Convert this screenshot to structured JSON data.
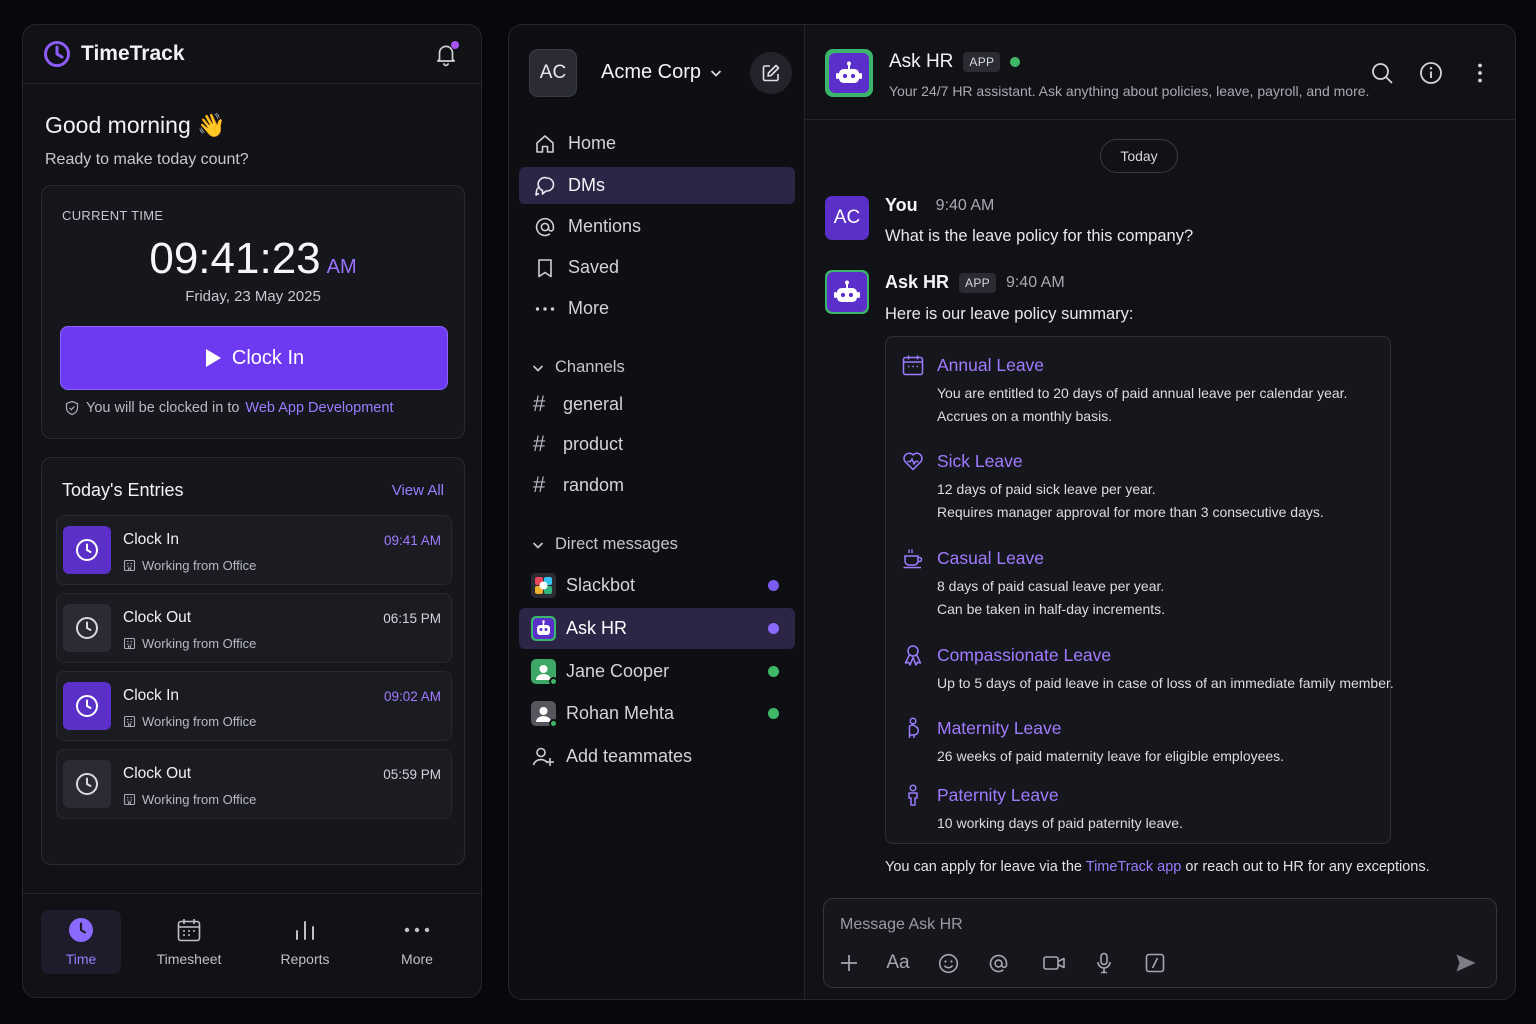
{
  "timetrack": {
    "brand": "TimeTrack",
    "greeting": "Good morning 👋",
    "subgreeting": "Ready to make today count?",
    "current_time_label": "CURRENT TIME",
    "time": "09:41:23",
    "ampm": "AM",
    "date": "Friday, 23 May 2025",
    "clock_in_label": "Clock In",
    "note_prefix": "You will be clocked in to",
    "note_project": "Web App Development",
    "entries_title": "Today's Entries",
    "view_all": "View All",
    "entries": [
      {
        "title": "Clock In",
        "sub": "Working from Office",
        "time": "09:41 AM",
        "kind": "in"
      },
      {
        "title": "Clock Out",
        "sub": "Working from Office",
        "time": "06:15 PM",
        "kind": "out"
      },
      {
        "title": "Clock In",
        "sub": "Working from Office",
        "time": "09:02 AM",
        "kind": "in"
      },
      {
        "title": "Clock Out",
        "sub": "Working from Office",
        "time": "05:59 PM",
        "kind": "out"
      }
    ],
    "nav": [
      {
        "label": "Time",
        "icon": "clock-icon",
        "active": true
      },
      {
        "label": "Timesheet",
        "icon": "calendar-icon"
      },
      {
        "label": "Reports",
        "icon": "bar-chart-icon"
      },
      {
        "label": "More",
        "icon": "more-dots-icon"
      }
    ]
  },
  "sidebar": {
    "workspace_initials": "AC",
    "workspace_name": "Acme Corp",
    "nav": [
      {
        "label": "Home",
        "icon": "home-icon"
      },
      {
        "label": "DMs",
        "icon": "chat-bubbles-icon",
        "active": true
      },
      {
        "label": "Mentions",
        "icon": "at-icon"
      },
      {
        "label": "Saved",
        "icon": "bookmark-icon"
      },
      {
        "label": "More",
        "icon": "more-dots-icon"
      }
    ],
    "channels_label": "Channels",
    "channels": [
      "general",
      "product",
      "random"
    ],
    "dms_label": "Direct messages",
    "dms": [
      {
        "name": "Slackbot",
        "presence": "#7c5cf0"
      },
      {
        "name": "Ask HR",
        "presence": "#8b6bff",
        "active": true
      },
      {
        "name": "Jane Cooper",
        "presence": "#3fb968"
      },
      {
        "name": "Rohan Mehta",
        "presence": "#3fb968"
      }
    ],
    "add_teammates": "Add teammates"
  },
  "chat": {
    "title": "Ask HR",
    "badge": "APP",
    "subtitle": "Your 24/7 HR assistant. Ask anything about policies, leave, payroll, and more.",
    "today": "Today",
    "messages": [
      {
        "author": "You",
        "avatar": "AC",
        "time": "9:40 AM",
        "text": "What is the leave policy for this company?"
      },
      {
        "author": "Ask HR",
        "badge": "APP",
        "time": "9:40 AM",
        "text": "Here is our leave policy summary:"
      }
    ],
    "policies": [
      {
        "title": "Annual Leave",
        "icon": "calendar-icon",
        "lines": [
          "You are entitled to 20 days of paid annual leave per calendar year.",
          "Accrues on a monthly basis."
        ]
      },
      {
        "title": "Sick Leave",
        "icon": "heart-pulse-icon",
        "lines": [
          "12 days of paid sick leave per year.",
          "Requires manager approval for more than 3 consecutive  days."
        ]
      },
      {
        "title": "Casual Leave",
        "icon": "coffee-cup-icon",
        "lines": [
          "8 days of paid casual leave per year.",
          "Can be taken in half-day increments."
        ]
      },
      {
        "title": "Compassionate Leave",
        "icon": "ribbon-icon",
        "lines": [
          "Up to 5 days of paid leave in case of loss of an immediate family member."
        ]
      },
      {
        "title": "Maternity Leave",
        "icon": "maternity-icon",
        "lines": [
          "26 weeks of paid maternity leave for eligible employees."
        ]
      },
      {
        "title": "Paternity Leave",
        "icon": "person-icon",
        "lines": [
          "10 working days of paid paternity leave."
        ]
      }
    ],
    "footer_prefix": "You can apply for leave via the",
    "footer_link": "TimeTrack app",
    "footer_suffix": "or reach out to HR for any exceptions.",
    "composer_placeholder": "Message Ask HR",
    "format_label": "Aa"
  },
  "colors": {
    "accent": "#6d3af2",
    "accent_text": "#9b7cff",
    "online": "#3fb968",
    "bot_bg": "#5b2fc9"
  }
}
